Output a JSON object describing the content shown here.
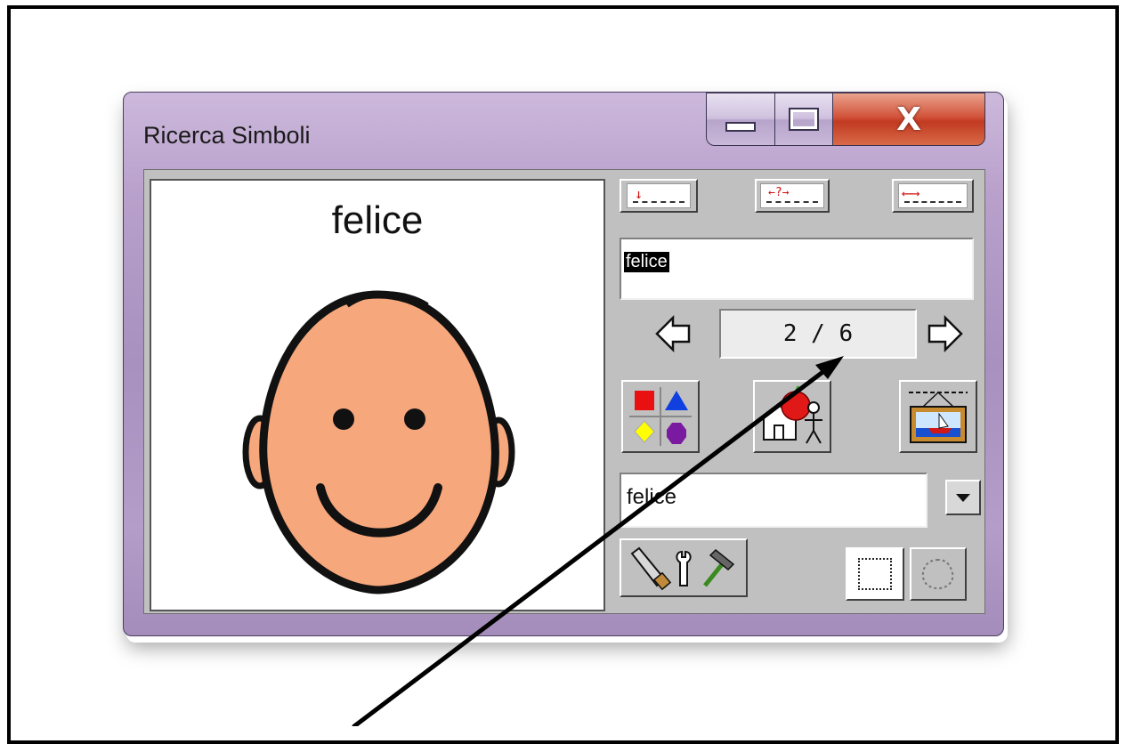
{
  "window": {
    "title": "Ricerca Simboli",
    "caption_buttons": {
      "minimize_icon": "minimize-icon",
      "maximize_icon": "maximize-icon",
      "close_icon": "close-icon",
      "close_glyph": "X"
    }
  },
  "preview": {
    "word": "felice",
    "symbol_icon": "happy-face-icon",
    "skin_color": "#f7a77c"
  },
  "toolbar_top": [
    {
      "name": "insert-symbol-button",
      "icon": "insert-down-arrow-icon",
      "glyph": "↓"
    },
    {
      "name": "replace-symbol-button",
      "icon": "replace-question-icon",
      "glyph": "←?→"
    },
    {
      "name": "stretch-symbol-button",
      "icon": "stretch-arrows-icon",
      "glyph": "⟵⟶"
    }
  ],
  "search": {
    "value": "felice"
  },
  "pager": {
    "text": "2 / 6",
    "current": 2,
    "total": 6,
    "prev_icon": "arrow-left-icon",
    "next_icon": "arrow-right-icon"
  },
  "category_buttons": [
    {
      "name": "shapes-colors-button",
      "icon": "shapes-colors-icon"
    },
    {
      "name": "categories-button",
      "icon": "house-apple-person-icon"
    },
    {
      "name": "picture-frame-button",
      "icon": "picture-frame-icon"
    }
  ],
  "combo": {
    "value": "felice",
    "dropdown_icon": "chevron-down-icon"
  },
  "tools": {
    "tools_icon": "saw-wrench-hammer-icon",
    "square_frame_icon": "square-frame-icon",
    "round_frame_icon": "round-frame-icon"
  },
  "colors": {
    "window_frame": "#b49dc8",
    "client_gray": "#c0c0c0",
    "close_red": "#c13a21"
  }
}
